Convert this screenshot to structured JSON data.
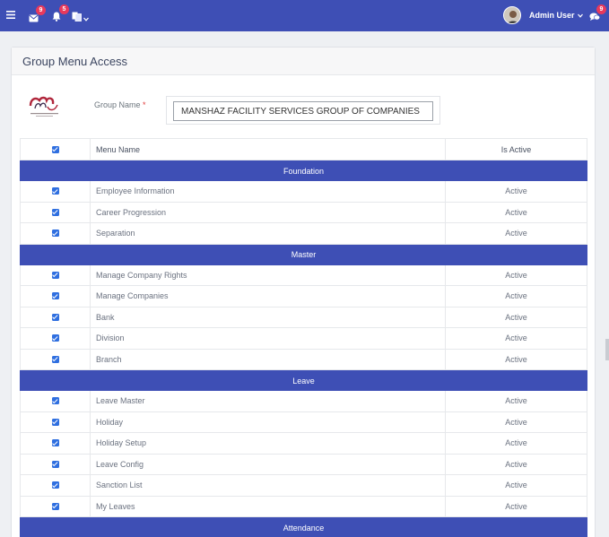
{
  "topbar": {
    "mail_badge": "9",
    "bell_badge": "5",
    "chat_badge": "9",
    "user_name": "Admin User",
    "icons": [
      "hamburger-menu-icon",
      "envelope-icon",
      "bell-icon",
      "language-icon",
      "chevron-down-icon",
      "chat-icon"
    ]
  },
  "card": {
    "title": "Group Menu Access",
    "group_label": "Group Name",
    "required_mark": "*",
    "group_value": "MANSHAZ FACILITY SERVICES GROUP OF COMPANIES"
  },
  "table": {
    "headers": {
      "menu_name": "Menu Name",
      "is_active": "Is Active"
    },
    "sections": [
      {
        "title": "Foundation",
        "rows": [
          {
            "name": "Employee Information",
            "status": "Active"
          },
          {
            "name": "Career Progression",
            "status": "Active"
          },
          {
            "name": "Separation",
            "status": "Active"
          }
        ]
      },
      {
        "title": "Master",
        "rows": [
          {
            "name": "Manage Company Rights",
            "status": "Active"
          },
          {
            "name": "Manage Companies",
            "status": "Active"
          },
          {
            "name": "Bank",
            "status": "Active"
          },
          {
            "name": "Division",
            "status": "Active"
          },
          {
            "name": "Branch",
            "status": "Active"
          }
        ]
      },
      {
        "title": "Leave",
        "rows": [
          {
            "name": "Leave Master",
            "status": "Active"
          },
          {
            "name": "Holiday",
            "status": "Active"
          },
          {
            "name": "Holiday Setup",
            "status": "Active"
          },
          {
            "name": "Leave Config",
            "status": "Active"
          },
          {
            "name": "Sanction List",
            "status": "Active"
          },
          {
            "name": "My Leaves",
            "status": "Active"
          }
        ]
      },
      {
        "title": "Attendance",
        "rows": []
      }
    ]
  },
  "colors": {
    "primary": "#3e4fb5",
    "badge": "#e8395c",
    "checkbox": "#2f6fe0"
  }
}
